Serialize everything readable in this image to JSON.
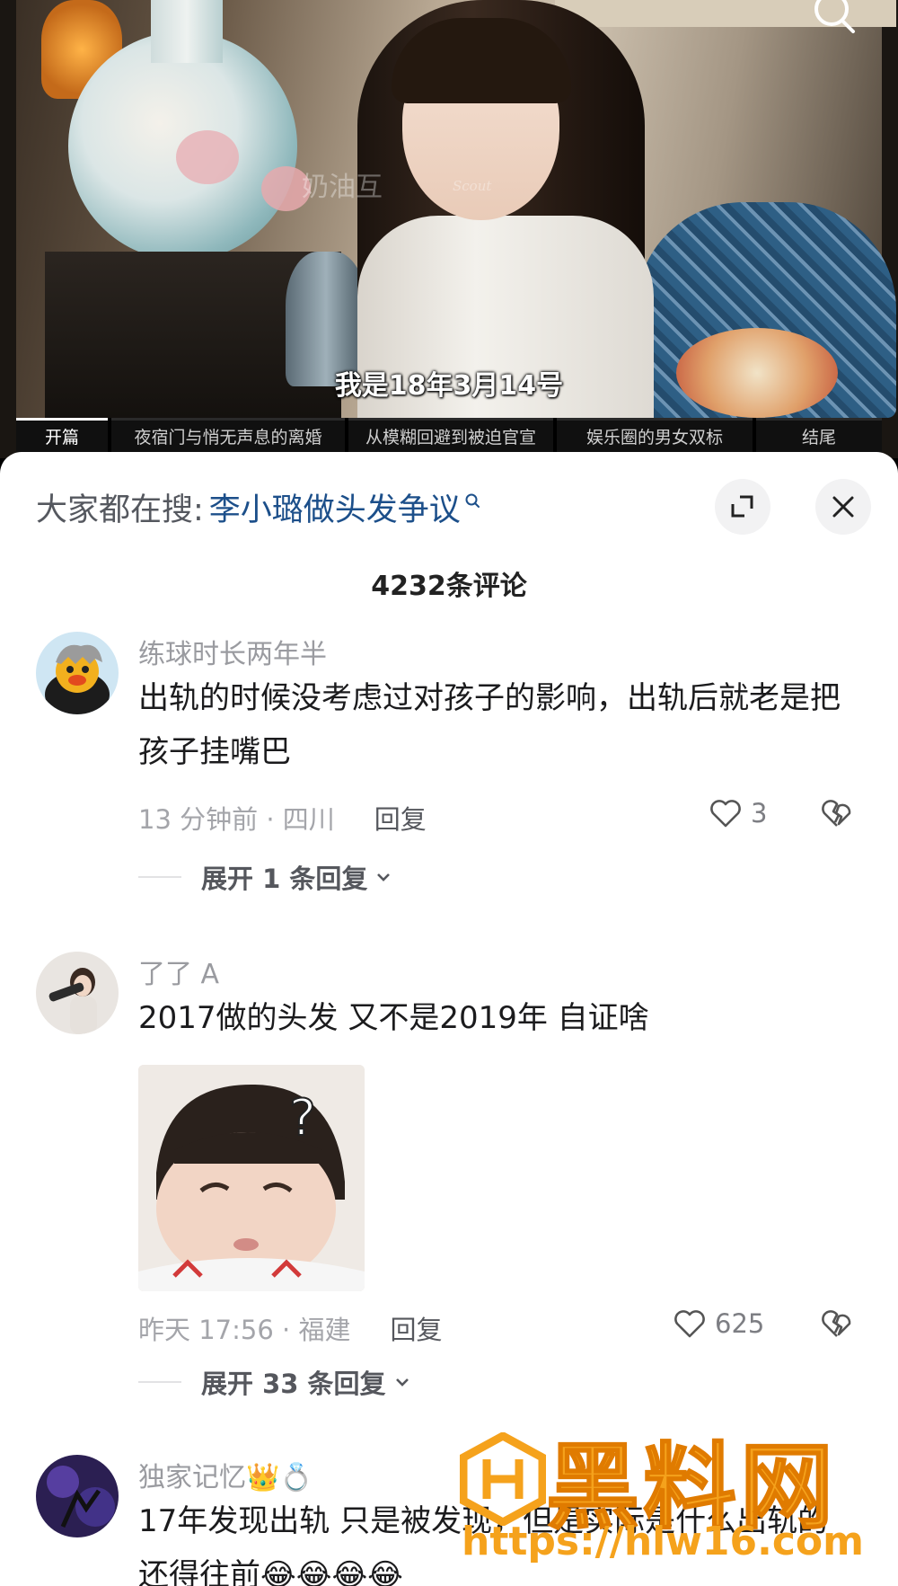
{
  "video": {
    "subtitle": "我是18年3月14号",
    "watermark": "奶油互",
    "watermark_en": "Scout",
    "chapters": [
      {
        "label": "开篇",
        "active": true
      },
      {
        "label": "夜宿门与悄无声息的离婚",
        "active": false
      },
      {
        "label": "从模糊回避到被迫官宣",
        "active": false
      },
      {
        "label": "娱乐圈的男女双标",
        "active": false
      },
      {
        "label": "结尾",
        "active": false
      }
    ]
  },
  "sheet": {
    "hot_search_prefix": "大家都在搜:",
    "hot_search_term": "李小璐做头发争议",
    "comment_count": "4232条评论"
  },
  "comments": [
    {
      "user": "练球时长两年半",
      "text": "出轨的时候没考虑过对孩子的影响，出轨后就老是把孩子挂嘴巴",
      "meta": "13 分钟前 · 四川",
      "reply": "回复",
      "likes": "3",
      "expand": "展开 1 条回复"
    },
    {
      "user": "了了 A",
      "text": "2017做的头发 又不是2019年 自证啥",
      "meta": "昨天 17:56 · 福建",
      "reply": "回复",
      "likes": "625",
      "expand": "展开 33 条回复"
    },
    {
      "user": "独家记忆👑💍",
      "text": "17年发现出轨 只是被发现，但是实际是什么出轨的还得往前😂😂😂😂"
    }
  ],
  "brand_watermark": {
    "name": "黑料网",
    "url": "https://hlw16.com"
  },
  "colors": {
    "accent_link": "#1c4f8a",
    "brand_orange": "#f5a21c"
  }
}
